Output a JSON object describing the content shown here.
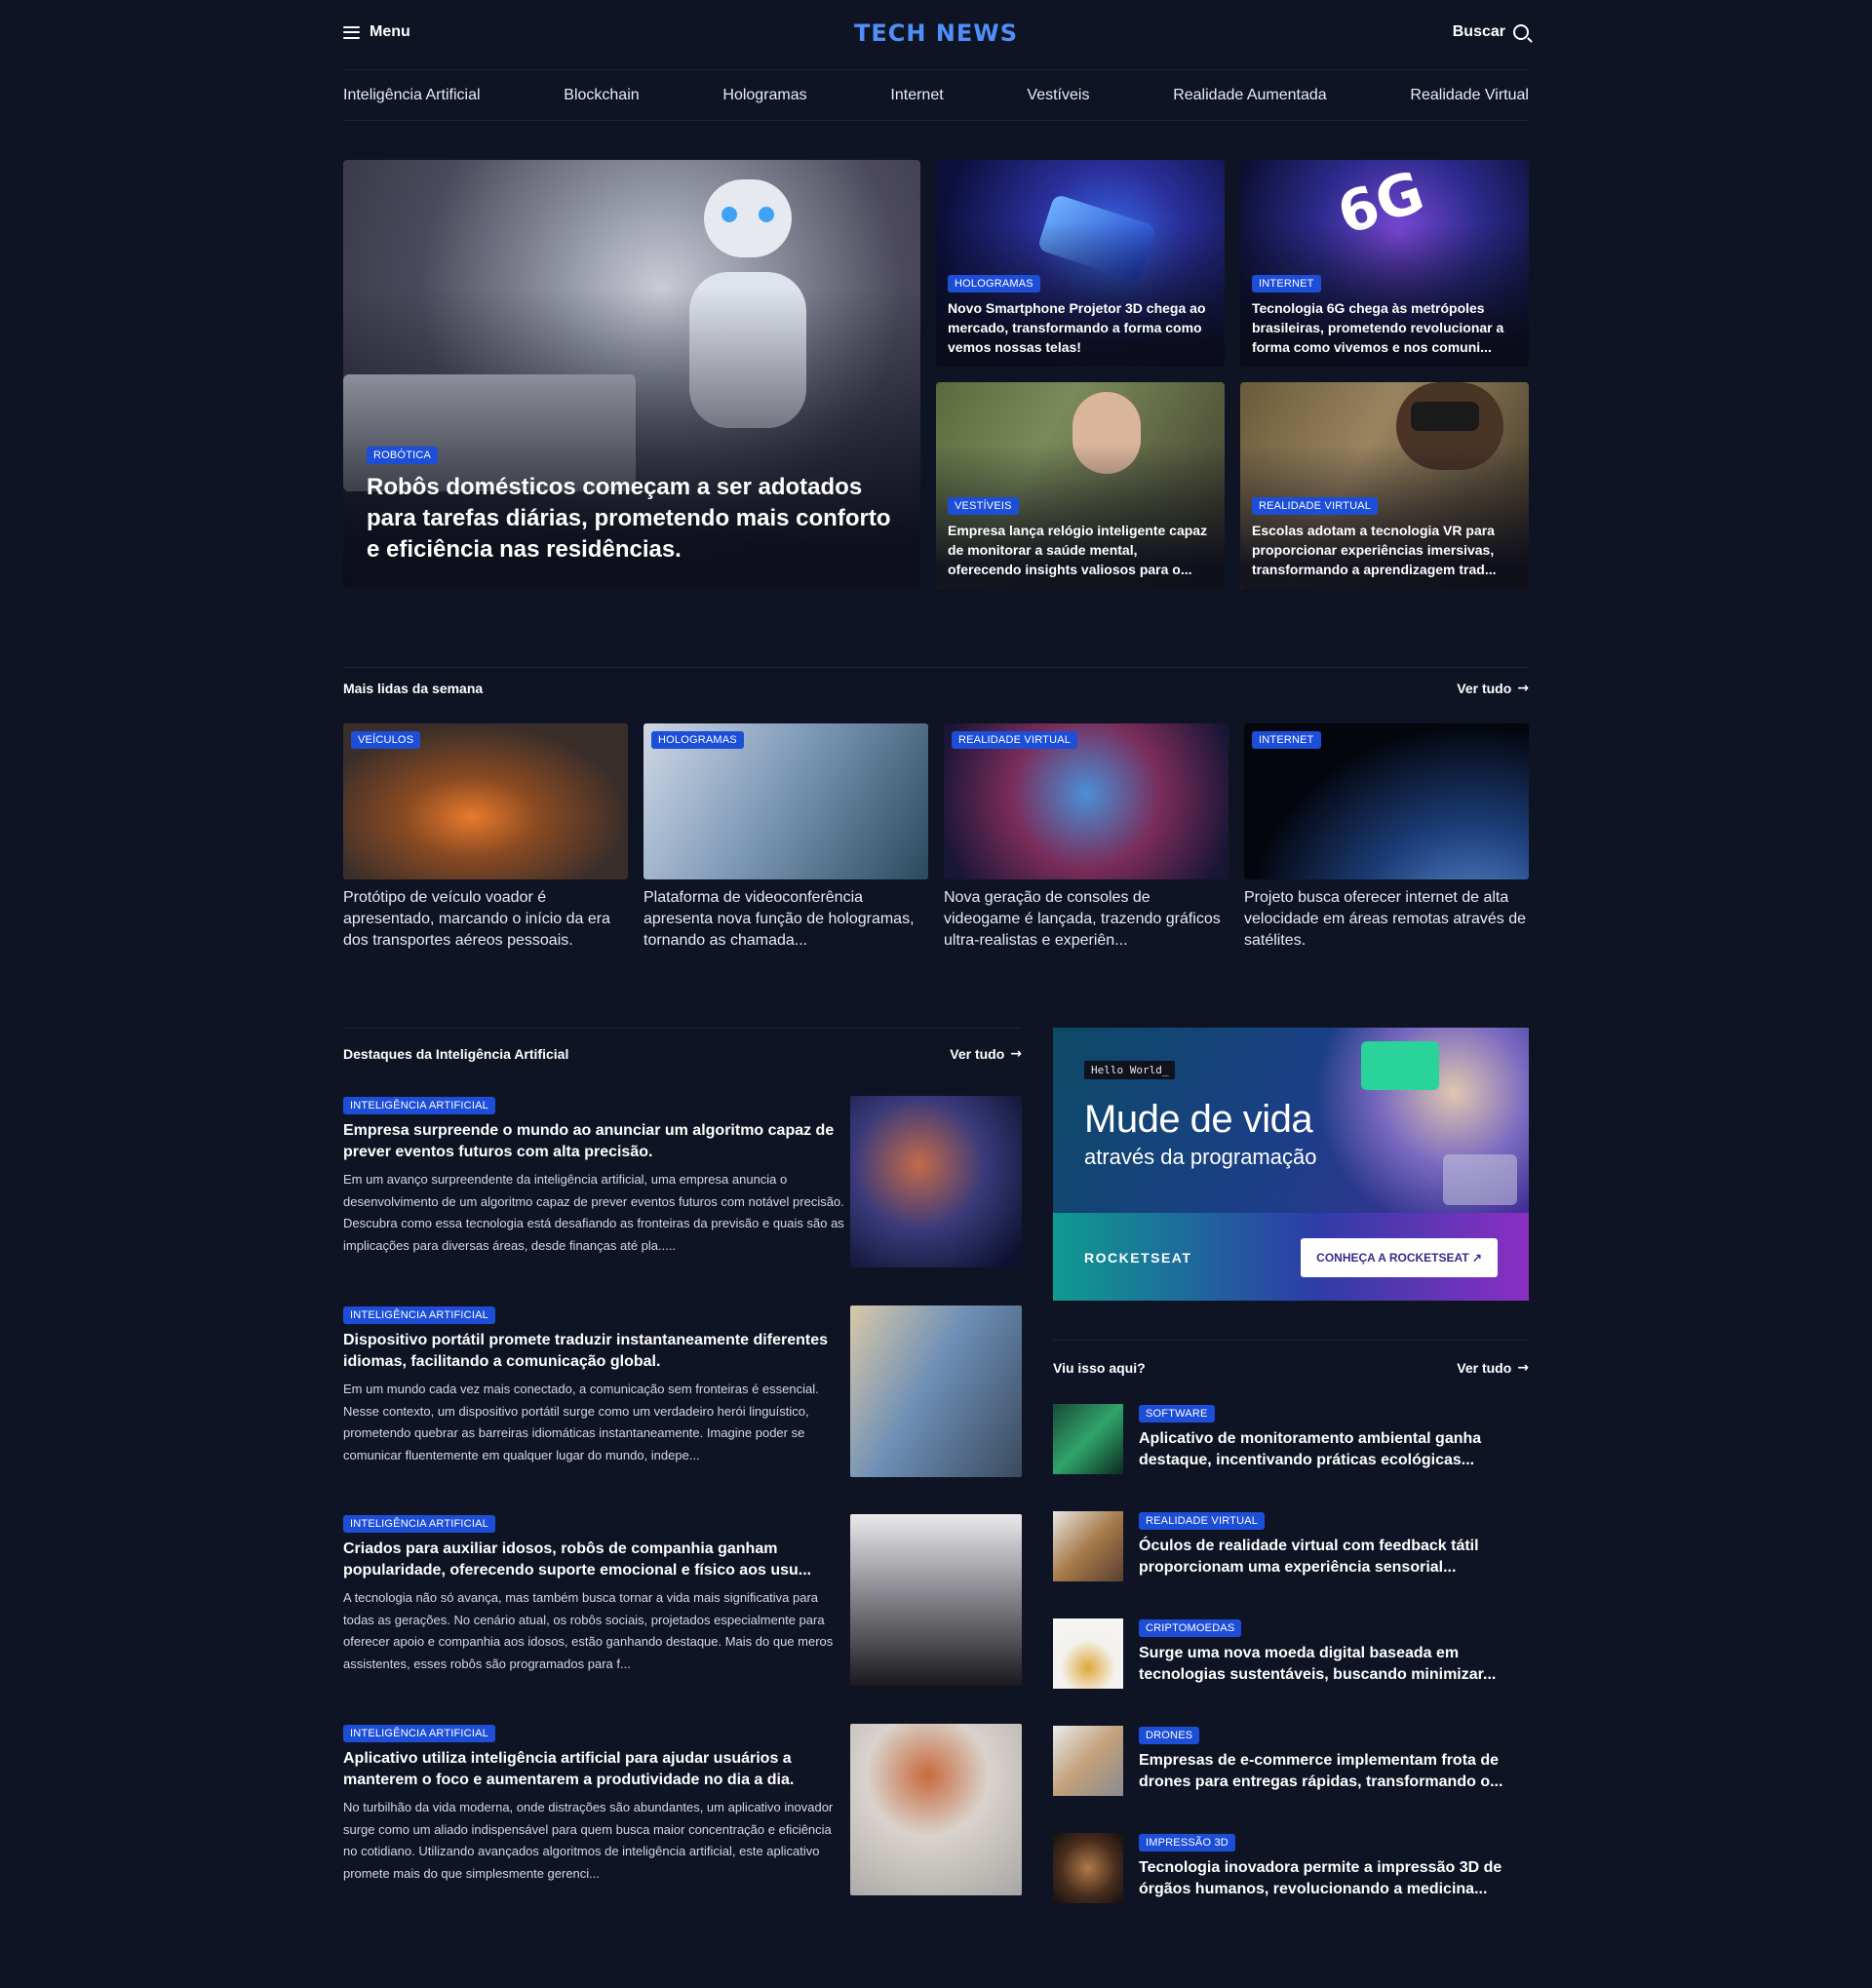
{
  "header": {
    "menu_label": "Menu",
    "logo": "TECH NEWS",
    "search_label": "Buscar"
  },
  "nav": [
    "Inteligência Artificial",
    "Blockchain",
    "Hologramas",
    "Internet",
    "Vestíveis",
    "Realidade Aumentada",
    "Realidade Virtual"
  ],
  "hero": {
    "main": {
      "tag": "Robótica",
      "title": "Robôs domésticos começam a ser adotados para tarefas diárias, prometendo mais conforto e eficiência nas residências."
    },
    "side": [
      {
        "tag": "Hologramas",
        "title": "Novo Smartphone Projetor 3D chega ao mercado, transformando a forma como vemos nossas telas!"
      },
      {
        "tag": "Internet",
        "title": "Tecnologia 6G chega às metrópoles brasileiras, prometendo revolucionar a forma como vivemos e nos comuni..."
      },
      {
        "tag": "Vestíveis",
        "title": "Empresa lança relógio inteligente capaz de monitorar a saúde mental, oferecendo insights valiosos para o..."
      },
      {
        "tag": "Realidade Virtual",
        "title": "Escolas adotam a tecnologia VR para proporcionar experiências imersivas, transformando a aprendizagem trad..."
      }
    ]
  },
  "most_read": {
    "title": "Mais lidas da semana",
    "see_all": "Ver tudo",
    "items": [
      {
        "tag": "Veículos",
        "title": "Protótipo de veículo voador é apresentado, marcando o início da era dos transportes aéreos pessoais."
      },
      {
        "tag": "Hologramas",
        "title": "Plataforma de videoconferência apresenta nova função de hologramas, tornando as chamada..."
      },
      {
        "tag": "Realidade Virtual",
        "title": "Nova geração de consoles de videogame é lançada, trazendo gráficos ultra-realistas e experiên..."
      },
      {
        "tag": "Internet",
        "title": "Projeto busca oferecer internet de alta velocidade em áreas remotas através de satélites."
      }
    ]
  },
  "ai": {
    "title": "Destaques da Inteligência Artificial",
    "see_all": "Ver tudo",
    "items": [
      {
        "tag": "Inteligência Artificial",
        "title": "Empresa surpreende o mundo ao anunciar um algoritmo capaz de prever eventos futuros com alta precisão.",
        "excerpt": "Em um avanço surpreendente da inteligência artificial, uma empresa anuncia o desenvolvimento de um algoritmo capaz de prever eventos futuros com notável precisão. Descubra como essa tecnologia está desafiando as fronteiras da previsão e quais são as implicações para diversas áreas, desde finanças até pla....."
      },
      {
        "tag": "Inteligência Artificial",
        "title": "Dispositivo portátil promete traduzir instantaneamente diferentes idiomas, facilitando a comunicação global.",
        "excerpt": "Em um mundo cada vez mais conectado, a comunicação sem fronteiras é essencial. Nesse contexto, um dispositivo portátil surge como um verdadeiro herói linguístico, prometendo quebrar as barreiras idiomáticas instantaneamente. Imagine poder se comunicar fluentemente em qualquer lugar do mundo, indepe..."
      },
      {
        "tag": "Inteligência Artificial",
        "title": "Criados para auxiliar idosos, robôs de companhia ganham popularidade, oferecendo suporte emocional e físico aos usu...",
        "excerpt": "A tecnologia não só avança, mas também busca tornar a vida mais significativa para todas as gerações. No cenário atual, os robôs sociais, projetados especialmente para oferecer apoio e companhia aos idosos, estão ganhando destaque. Mais do que meros assistentes, esses robôs são programados para f..."
      },
      {
        "tag": "Inteligência Artificial",
        "title": "Aplicativo utiliza inteligência artificial para ajudar usuários a manterem o foco e aumentarem a produtividade no dia a dia.",
        "excerpt": "No turbilhão da vida moderna, onde distrações são abundantes, um aplicativo inovador surge como um aliado indispensável para quem busca maior concentração e eficiência no cotidiano. Utilizando avançados algoritmos de inteligência artificial, este aplicativo promete mais do que simplesmente gerenci..."
      }
    ]
  },
  "ad": {
    "hello": "Hello World_",
    "headline": "Mude de vida",
    "subline": "através da programação",
    "brand": "ROCKETSEAT",
    "cta": "CONHEÇA A ROCKETSEAT ↗"
  },
  "seen": {
    "title": "Viu isso aqui?",
    "see_all": "Ver tudo",
    "items": [
      {
        "tag": "Software",
        "title": "Aplicativo de monitoramento ambiental ganha destaque, incentivando práticas ecológicas..."
      },
      {
        "tag": "Realidade Virtual",
        "title": "Óculos de realidade virtual com feedback tátil proporcionam uma experiência sensorial..."
      },
      {
        "tag": "Criptomoedas",
        "title": "Surge uma nova moeda digital baseada em tecnologias sustentáveis, buscando minimizar..."
      },
      {
        "tag": "Drones",
        "title": "Empresas de e-commerce implementam frota de drones para entregas rápidas, transformando o..."
      },
      {
        "tag": "Impressão 3D",
        "title": "Tecnologia inovadora permite a impressão 3D de órgãos humanos, revolucionando a medicina..."
      }
    ]
  },
  "colors": {
    "background": "#0f1425",
    "accent": "#4f8ff7",
    "tag": "#1d4ed8"
  }
}
